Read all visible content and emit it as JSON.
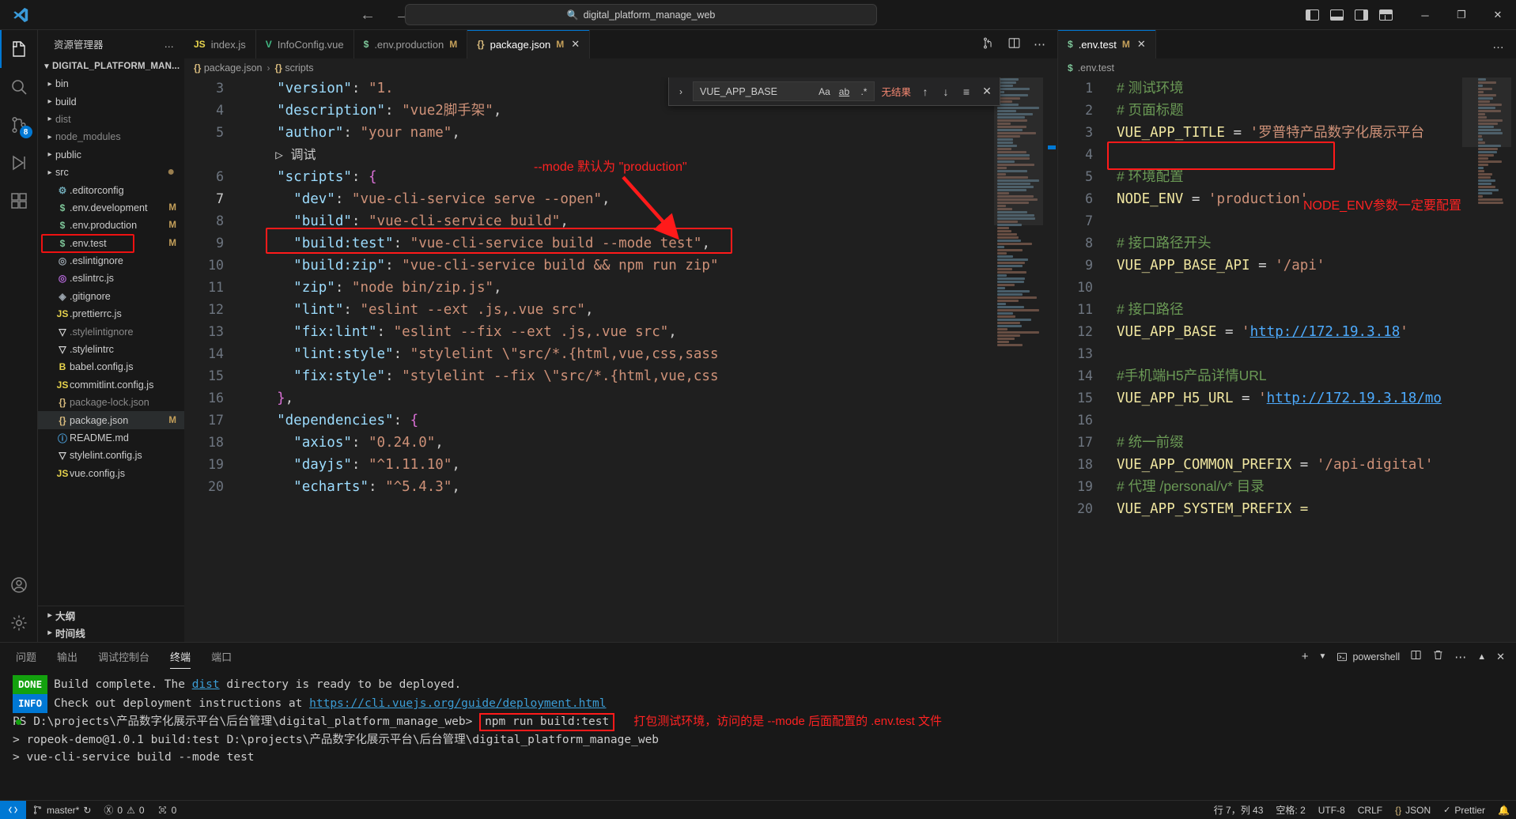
{
  "titlebar": {
    "search_text": "digital_platform_manage_web",
    "search_icon": "magnifier-icon",
    "back_icon": "arrow-left-icon",
    "forward_icon": "arrow-right-icon",
    "minimize": "─",
    "maximize": "❐",
    "close": "✕"
  },
  "activity_bar": {
    "items": [
      {
        "name": "explorer",
        "icon": "files-icon",
        "badge": ""
      },
      {
        "name": "search",
        "icon": "search-icon",
        "badge": ""
      },
      {
        "name": "source-control",
        "icon": "source-control-icon",
        "badge": "8"
      },
      {
        "name": "run-debug",
        "icon": "run-debug-icon",
        "badge": ""
      },
      {
        "name": "extensions",
        "icon": "extensions-icon",
        "badge": ""
      }
    ],
    "bottom": [
      {
        "name": "accounts",
        "icon": "account-icon"
      },
      {
        "name": "settings",
        "icon": "gear-icon"
      }
    ]
  },
  "sidebar": {
    "title": "资源管理器",
    "more_label": "…",
    "root_label": "DIGITAL_PLATFORM_MAN...",
    "items": [
      {
        "name": "bin",
        "type": "folder",
        "icon": "›",
        "mark": "",
        "dim": false
      },
      {
        "name": "build",
        "type": "folder",
        "icon": "›",
        "mark": "",
        "dim": false
      },
      {
        "name": "dist",
        "type": "folder",
        "icon": "›",
        "mark": "",
        "dim": true
      },
      {
        "name": "node_modules",
        "type": "folder",
        "icon": "›",
        "mark": "",
        "dim": true
      },
      {
        "name": "public",
        "type": "folder",
        "icon": "›",
        "mark": "",
        "dim": false
      },
      {
        "name": "src",
        "type": "folder",
        "icon": "›",
        "mark": "●",
        "dim": false
      },
      {
        "name": ".editorconfig",
        "type": "file",
        "icon": "⚙",
        "mark": "",
        "dim": false
      },
      {
        "name": ".env.development",
        "type": "file",
        "icon": "$",
        "mark": "M",
        "dim": false
      },
      {
        "name": ".env.production",
        "type": "file",
        "icon": "$",
        "mark": "M",
        "dim": false
      },
      {
        "name": ".env.test",
        "type": "file",
        "icon": "$",
        "mark": "M",
        "dim": false,
        "highlighted": true
      },
      {
        "name": ".eslintignore",
        "type": "file",
        "icon": "◎",
        "mark": "",
        "dim": false
      },
      {
        "name": ".eslintrc.js",
        "type": "file",
        "icon": "◎",
        "mark": "",
        "dim": false
      },
      {
        "name": ".gitignore",
        "type": "file",
        "icon": "◈",
        "mark": "",
        "dim": false
      },
      {
        "name": ".prettierrc.js",
        "type": "file",
        "icon": "JS",
        "mark": "",
        "dim": false
      },
      {
        "name": ".stylelintignore",
        "type": "file",
        "icon": "▽",
        "mark": "",
        "dim": true
      },
      {
        "name": ".stylelintrc",
        "type": "file",
        "icon": "▽",
        "mark": "",
        "dim": false
      },
      {
        "name": "babel.config.js",
        "type": "file",
        "icon": "B",
        "mark": "",
        "dim": false
      },
      {
        "name": "commitlint.config.js",
        "type": "file",
        "icon": "JS",
        "mark": "",
        "dim": false
      },
      {
        "name": "package-lock.json",
        "type": "file",
        "icon": "{}",
        "mark": "",
        "dim": true
      },
      {
        "name": "package.json",
        "type": "file",
        "icon": "{}",
        "mark": "M",
        "dim": false,
        "selected": true
      },
      {
        "name": "README.md",
        "type": "file",
        "icon": "ⓘ",
        "mark": "",
        "dim": false
      },
      {
        "name": "stylelint.config.js",
        "type": "file",
        "icon": "▽",
        "mark": "",
        "dim": false
      },
      {
        "name": "vue.config.js",
        "type": "file",
        "icon": "JS",
        "mark": "",
        "dim": false
      }
    ],
    "sections": [
      {
        "name": "outline",
        "label": "大纲"
      },
      {
        "name": "timeline",
        "label": "时间线"
      }
    ]
  },
  "editor_left": {
    "tabs": [
      {
        "label": "index.js",
        "icon": "JS",
        "modified": "",
        "active": false,
        "closable": false
      },
      {
        "label": "InfoConfig.vue",
        "icon": "V",
        "modified": "",
        "active": false,
        "closable": false
      },
      {
        "label": ".env.production",
        "icon": "$",
        "modified": "M",
        "active": false,
        "closable": false
      },
      {
        "label": "package.json",
        "icon": "{}",
        "modified": "M",
        "active": true,
        "closable": true
      }
    ],
    "breadcrumb": [
      {
        "icon": "{}",
        "label": "package.json"
      },
      {
        "icon": "{}",
        "label": "scripts"
      }
    ],
    "actions": [
      "split-editor-icon",
      "split-layout-icon",
      "more-actions-icon"
    ],
    "lines": [
      {
        "num": "3",
        "modified": false,
        "text": "  \"version\": \"1."
      },
      {
        "num": "4",
        "modified": false,
        "text": "  \"description\": \"vue2脚手架\","
      },
      {
        "num": "5",
        "modified": false,
        "text": "  \"author\": \"your name\","
      },
      {
        "num": "",
        "modified": false,
        "text": "  ▷ 调试"
      },
      {
        "num": "6",
        "modified": false,
        "text": "  \"scripts\": {"
      },
      {
        "num": "7",
        "modified": true,
        "text": "    \"dev\": \"vue-cli-service serve --open\","
      },
      {
        "num": "8",
        "modified": true,
        "text": "    \"build\": \"vue-cli-service build\","
      },
      {
        "num": "9",
        "modified": true,
        "text": "    \"build:test\": \"vue-cli-service build --mode test\","
      },
      {
        "num": "10",
        "modified": false,
        "text": "    \"build:zip\": \"vue-cli-service build && npm run zip\""
      },
      {
        "num": "11",
        "modified": false,
        "text": "    \"zip\": \"node bin/zip.js\","
      },
      {
        "num": "12",
        "modified": false,
        "text": "    \"lint\": \"eslint --ext .js,.vue src\","
      },
      {
        "num": "13",
        "modified": false,
        "text": "    \"fix:lint\": \"eslint --fix --ext .js,.vue src\","
      },
      {
        "num": "14",
        "modified": false,
        "text": "    \"lint:style\": \"stylelint \\\"src/*.{html,vue,css,sass"
      },
      {
        "num": "15",
        "modified": false,
        "text": "    \"fix:style\": \"stylelint --fix \\\"src/*.{html,vue,css"
      },
      {
        "num": "16",
        "modified": false,
        "text": "  },"
      },
      {
        "num": "17",
        "modified": false,
        "text": "  \"dependencies\": {"
      },
      {
        "num": "18",
        "modified": false,
        "text": "    \"axios\": \"0.24.0\","
      },
      {
        "num": "19",
        "modified": false,
        "text": "    \"dayjs\": \"^1.11.10\","
      },
      {
        "num": "20",
        "modified": false,
        "text": "    \"echarts\": \"^5.4.3\","
      }
    ],
    "annotation_mode": "--mode 默认为 \"production\""
  },
  "find_widget": {
    "query": "VUE_APP_BASE",
    "match_case_label": "Aa",
    "whole_word_label": "ab",
    "regex_label": ".*",
    "result_text": "无结果",
    "prev_icon": "arrow-up-icon",
    "next_icon": "arrow-down-icon",
    "selection_icon": "find-in-selection-icon",
    "close_icon": "close-icon",
    "expand_icon": "chevron-right-icon"
  },
  "editor_right": {
    "tab": {
      "label": ".env.test",
      "icon": "$",
      "modified": "M",
      "close": "✕"
    },
    "breadcrumb": {
      "icon": "$",
      "label": ".env.test"
    },
    "more_actions": "…",
    "lines": [
      {
        "num": "1",
        "modified": false,
        "parts": [
          {
            "t": "# 测试环境",
            "c": "envcn"
          }
        ]
      },
      {
        "num": "2",
        "modified": false,
        "parts": [
          {
            "t": "# 页面标题",
            "c": "envcn"
          }
        ]
      },
      {
        "num": "3",
        "modified": false,
        "parts": [
          {
            "t": "VUE_APP_TITLE ",
            "c": "envk"
          },
          {
            "t": "= ",
            "c": "envop"
          },
          {
            "t": "'罗普特产品数字化展示平台",
            "c": "envv"
          }
        ]
      },
      {
        "num": "4",
        "modified": false,
        "parts": []
      },
      {
        "num": "5",
        "modified": false,
        "parts": [
          {
            "t": "# 环境配置",
            "c": "envcn"
          }
        ]
      },
      {
        "num": "6",
        "modified": true,
        "parts": [
          {
            "t": "NODE_ENV ",
            "c": "envk"
          },
          {
            "t": "= ",
            "c": "envop"
          },
          {
            "t": "'production'",
            "c": "envv"
          }
        ]
      },
      {
        "num": "7",
        "modified": false,
        "parts": []
      },
      {
        "num": "8",
        "modified": false,
        "parts": [
          {
            "t": "# 接口路径开头",
            "c": "envcn"
          }
        ]
      },
      {
        "num": "9",
        "modified": false,
        "parts": [
          {
            "t": "VUE_APP_BASE_API ",
            "c": "envk"
          },
          {
            "t": "= ",
            "c": "envop"
          },
          {
            "t": "'/api'",
            "c": "envv"
          }
        ]
      },
      {
        "num": "10",
        "modified": false,
        "parts": []
      },
      {
        "num": "11",
        "modified": false,
        "parts": [
          {
            "t": "# 接口路径",
            "c": "envcn"
          }
        ]
      },
      {
        "num": "12",
        "modified": false,
        "parts": [
          {
            "t": "VUE_APP_BASE ",
            "c": "envk"
          },
          {
            "t": "= ",
            "c": "envop"
          },
          {
            "t": "'",
            "c": "envv"
          },
          {
            "t": "http://172.19.3.18",
            "c": "lnk"
          },
          {
            "t": "'",
            "c": "envv"
          }
        ]
      },
      {
        "num": "13",
        "modified": false,
        "parts": []
      },
      {
        "num": "14",
        "modified": false,
        "parts": [
          {
            "t": "#手机端H5产品详情URL",
            "c": "envcn"
          }
        ]
      },
      {
        "num": "15",
        "modified": false,
        "parts": [
          {
            "t": "VUE_APP_H5_URL ",
            "c": "envk"
          },
          {
            "t": "= ",
            "c": "envop"
          },
          {
            "t": "'",
            "c": "envv"
          },
          {
            "t": "http://172.19.3.18/mo",
            "c": "lnk"
          }
        ]
      },
      {
        "num": "16",
        "modified": false,
        "parts": []
      },
      {
        "num": "17",
        "modified": false,
        "parts": [
          {
            "t": "# 统一前缀",
            "c": "envcn"
          }
        ]
      },
      {
        "num": "18",
        "modified": false,
        "parts": [
          {
            "t": "VUE_APP_COMMON_PREFIX ",
            "c": "envk"
          },
          {
            "t": "= ",
            "c": "envop"
          },
          {
            "t": "'/api-digital'",
            "c": "envv"
          }
        ]
      },
      {
        "num": "19",
        "modified": false,
        "parts": [
          {
            "t": "# 代理 /personal/v* 目录",
            "c": "envcn"
          }
        ]
      },
      {
        "num": "20",
        "modified": false,
        "parts": [
          {
            "t": "VUE_APP_SYSTEM_PREFIX = ",
            "c": "envk"
          }
        ]
      }
    ],
    "annotation_node_env": "NODE_ENV参数一定要配置"
  },
  "panel": {
    "tabs": [
      {
        "label": "问题",
        "active": false
      },
      {
        "label": "输出",
        "active": false
      },
      {
        "label": "调试控制台",
        "active": false
      },
      {
        "label": "终端",
        "active": true
      },
      {
        "label": "端口",
        "active": false
      }
    ],
    "shell_name": "powershell",
    "actions": [
      "add-terminal-icon",
      "chevron-down-icon",
      "split-terminal-icon",
      "trash-icon",
      "more-icon",
      "chevron-up-icon",
      "close-icon"
    ],
    "terminal": {
      "lines": [
        {
          "tag": "DONE",
          "tag_color": "#13a10e",
          "segments": [
            {
              "t": "Build complete. The ",
              "c": "p"
            },
            {
              "t": "dist",
              "c": "tlink"
            },
            {
              "t": " directory is ready to be deployed.",
              "c": "p"
            }
          ]
        },
        {
          "tag": "INFO",
          "tag_color": "#0078d4",
          "segments": [
            {
              "t": "Check out deployment instructions at ",
              "c": "p"
            },
            {
              "t": "https://cli.vuejs.org/guide/deployment.html",
              "c": "tlink"
            }
          ]
        },
        {
          "tag": "",
          "segments": []
        },
        {
          "tag": "",
          "segments": [
            {
              "t": "PS D:\\projects\\产品数字化展示平台\\后台管理\\digital_platform_manage_web> ",
              "c": "p"
            },
            {
              "t": "npm run build:test",
              "c": "p",
              "boxed": true
            }
          ]
        },
        {
          "tag": "",
          "segments": []
        },
        {
          "tag": "",
          "segments": [
            {
              "t": "> ropeok-demo@1.0.1 build:test D:\\projects\\产品数字化展示平台\\后台管理\\digital_platform_manage_web",
              "c": "p"
            }
          ]
        },
        {
          "tag": "",
          "segments": [
            {
              "t": "> vue-cli-service build --mode test",
              "c": "p"
            }
          ]
        }
      ],
      "annotation": "打包测试环境，访问的是 --mode 后面配置的 .env.test 文件"
    }
  },
  "status_bar": {
    "remote_icon": "remote-indicator-icon",
    "branch": "master*",
    "sync_icon": "sync-icon",
    "errors": "0",
    "warnings": "0",
    "ports": "0",
    "cursor": "行 7，列 43",
    "spaces": "空格: 2",
    "encoding": "UTF-8",
    "eol": "CRLF",
    "language": "JSON",
    "prettier": "Prettier",
    "notifications": "bell-icon"
  },
  "colors": {
    "accent": "#0078d4",
    "annotation_red": "#ff1a1a",
    "modified_marker": "#c5a05a",
    "done_green": "#13a10e"
  }
}
